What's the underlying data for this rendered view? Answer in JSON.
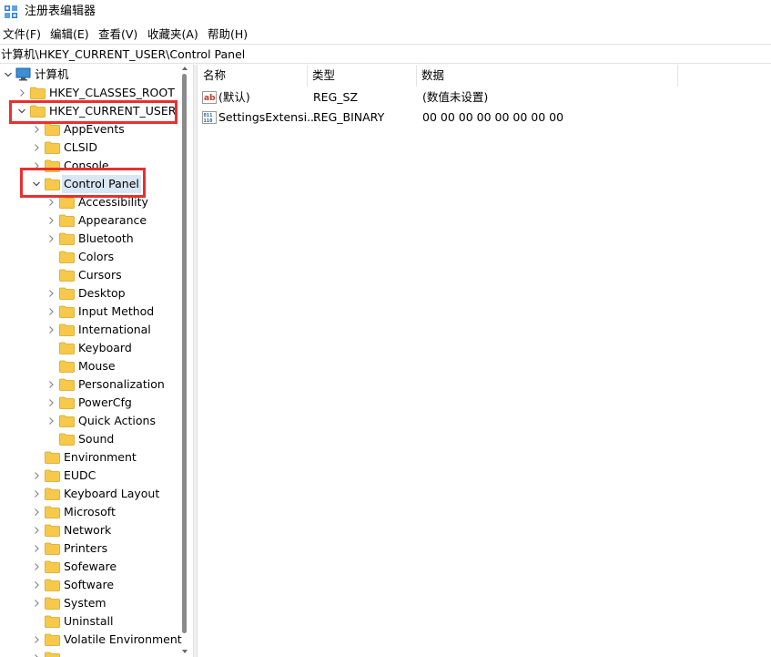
{
  "window": {
    "title": "注册表编辑器"
  },
  "menu": [
    "文件(F)",
    "编辑(E)",
    "查看(V)",
    "收藏夹(A)",
    "帮助(H)"
  ],
  "address": "计算机\\HKEY_CURRENT_USER\\Control Panel",
  "tree": {
    "root": "计算机",
    "hkey_classes_root": "HKEY_CLASSES_ROOT",
    "hkey_current_user": "HKEY_CURRENT_USER",
    "hkcu_children_before": [
      "AppEvents",
      "CLSID",
      "Console"
    ],
    "control_panel": "Control Panel",
    "control_panel_children": [
      {
        "label": "Accessibility",
        "expandable": true
      },
      {
        "label": "Appearance",
        "expandable": true
      },
      {
        "label": "Bluetooth",
        "expandable": true
      },
      {
        "label": "Colors",
        "expandable": false
      },
      {
        "label": "Cursors",
        "expandable": false
      },
      {
        "label": "Desktop",
        "expandable": true
      },
      {
        "label": "Input Method",
        "expandable": true
      },
      {
        "label": "International",
        "expandable": true
      },
      {
        "label": "Keyboard",
        "expandable": false
      },
      {
        "label": "Mouse",
        "expandable": false
      },
      {
        "label": "Personalization",
        "expandable": true
      },
      {
        "label": "PowerCfg",
        "expandable": true
      },
      {
        "label": "Quick Actions",
        "expandable": true
      },
      {
        "label": "Sound",
        "expandable": false
      }
    ],
    "hkcu_children_after": [
      {
        "label": "Environment",
        "expandable": false
      },
      {
        "label": "EUDC",
        "expandable": true
      },
      {
        "label": "Keyboard Layout",
        "expandable": true
      },
      {
        "label": "Microsoft",
        "expandable": true
      },
      {
        "label": "Network",
        "expandable": true
      },
      {
        "label": "Printers",
        "expandable": true
      },
      {
        "label": "Sofeware",
        "expandable": true
      },
      {
        "label": "Software",
        "expandable": true
      },
      {
        "label": "System",
        "expandable": true
      },
      {
        "label": "Uninstall",
        "expandable": false
      },
      {
        "label": "Volatile Environment",
        "expandable": true
      }
    ]
  },
  "list": {
    "columns": [
      "名称",
      "类型",
      "数据"
    ],
    "rows": [
      {
        "icon": "string-value-icon",
        "name": "(默认)",
        "type": "REG_SZ",
        "data": "(数值未设置)"
      },
      {
        "icon": "binary-value-icon",
        "name": "SettingsExtensi...",
        "type": "REG_BINARY",
        "data": "00 00 00 00 00 00 00 00"
      }
    ]
  },
  "colors": {
    "highlight": "#e8302f",
    "selected": "#d9e6f4",
    "folder": "#f6c94a"
  }
}
